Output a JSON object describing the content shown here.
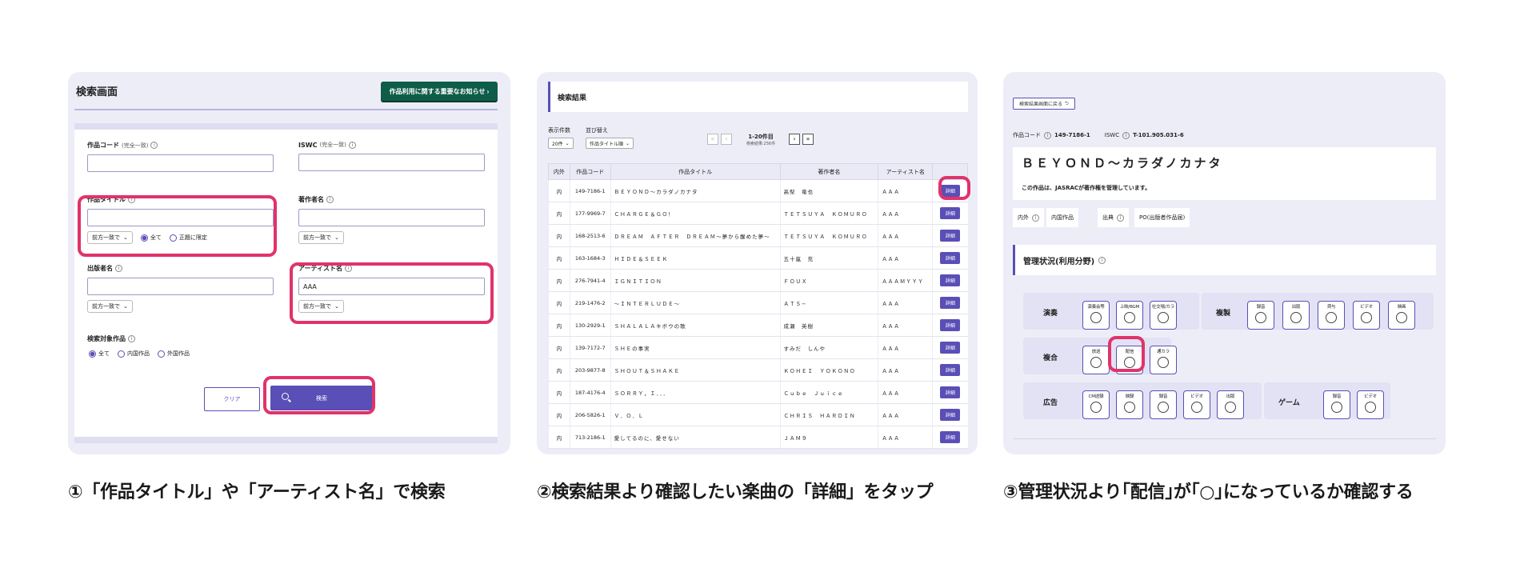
{
  "panel1": {
    "title": "検索画面",
    "notice_button": "作品利用に関する重要なお知らせ ›",
    "fields": {
      "work_code": {
        "label": "作品コード",
        "sub": "(完全一致)",
        "value": ""
      },
      "iswc": {
        "label": "ISWC",
        "sub": "(完全一致)",
        "value": ""
      },
      "title": {
        "label": "作品タイトル",
        "value": "",
        "match": "前方一致で",
        "radios": [
          "全て",
          "正題に限定"
        ],
        "selected": "全て"
      },
      "author": {
        "label": "著作者名",
        "value": "",
        "match": "前方一致で"
      },
      "publisher": {
        "label": "出版者名",
        "value": "",
        "match": "前方一致で"
      },
      "artist": {
        "label": "アーティスト名",
        "value": "AAA",
        "match": "前方一致で"
      },
      "target": {
        "label": "検索対象作品",
        "radios": [
          "全て",
          "内国作品",
          "外国作品"
        ],
        "selected": "全て"
      }
    },
    "clear_button": "クリア",
    "search_button": "検索",
    "caption": "①「作品タイトル」や「アーティスト名」で検索"
  },
  "panel2": {
    "header": "検索結果",
    "display_count": {
      "label": "表示件数",
      "value": "20件"
    },
    "sort": {
      "label": "並び替え",
      "value": "作品タイトル順"
    },
    "page_range": "1-20件目",
    "total": "検索結果:256件",
    "columns": [
      "内外",
      "作品コード",
      "作品タイトル",
      "著作者名",
      "アーティスト名",
      ""
    ],
    "detail_label": "詳細",
    "rows": [
      {
        "io": "内",
        "code": "149-7186-1",
        "title": "ＢＥＹＯＮＤ〜カラダノカナタ",
        "author": "高梨　竜也",
        "artist": "ＡＡＡ"
      },
      {
        "io": "内",
        "code": "177-9969-7",
        "title": "ＣＨＡＲＧＥ＆ＧＯ！",
        "author": "ＴＥＴＳＵＹＡ　ＫＯＭＵＲＯ",
        "artist": "ＡＡＡ"
      },
      {
        "io": "内",
        "code": "168-2513-6",
        "title": "ＤＲＥＡＭ　ＡＦＴＥＲ　ＤＲＥＡＭ〜夢から醒めた夢〜",
        "author": "ＴＥＴＳＵＹＡ　ＫＯＭＵＲＯ",
        "artist": "ＡＡＡ"
      },
      {
        "io": "内",
        "code": "163-1684-3",
        "title": "ＨＩＤＥ＆ＳＥＥＫ",
        "author": "五十嵐　充",
        "artist": "ＡＡＡ"
      },
      {
        "io": "内",
        "code": "276-7941-4",
        "title": "ＩＧＮＩＴＩＯＮ",
        "author": "ＦＯＵＸ",
        "artist": "ＡＡＡＭＹＹＹ"
      },
      {
        "io": "内",
        "code": "219-1476-2",
        "title": "〜ＩＮＴＥＲＬＵＤＥ〜",
        "author": "ＡＴＳ−",
        "artist": "ＡＡＡ"
      },
      {
        "io": "内",
        "code": "130-2929-1",
        "title": "ＳＨＡＬＡＬＡキボウの歌",
        "author": "成瀬　英樹",
        "artist": "ＡＡＡ"
      },
      {
        "io": "内",
        "code": "139-7172-7",
        "title": "ＳＨＥの事実",
        "author": "すみだ　しんや",
        "artist": "ＡＡＡ"
      },
      {
        "io": "内",
        "code": "203-9877-8",
        "title": "ＳＨＯＵＴ＆ＳＨＡＫＥ",
        "author": "ＫＯＨＥＩ　ＹＯＫＯＮＯ",
        "artist": "ＡＡＡ"
      },
      {
        "io": "内",
        "code": "187-4176-4",
        "title": "ＳＯＲＲＹ，Ｉ．．．",
        "author": "Ｃｕｂｅ　Ｊｕｉｃｅ",
        "artist": "ＡＡＡ"
      },
      {
        "io": "内",
        "code": "206-5826-1",
        "title": "Ｖ．Ｏ．Ｌ",
        "author": "ＣＨＲＩＳ　ＨＡＲＤＩＮ",
        "artist": "ＡＡＡ"
      },
      {
        "io": "内",
        "code": "713-2186-1",
        "title": "愛してるのに、愛せない",
        "author": "ＪＡＭ９",
        "artist": "ＡＡＡ"
      }
    ],
    "caption": "②検索結果より確認したい楽曲の「詳細」をタップ"
  },
  "panel3": {
    "back_button": "検索結果画面に戻る",
    "work_code_label": "作品コード",
    "work_code": "149-7186-1",
    "iswc_label": "ISWC",
    "iswc": "T-101.905.031-6",
    "work_title": "ＢＥＹＯＮＤ〜カラダノカナタ",
    "managed_note": "この作品は、JASRACが著作権を管理しています。",
    "io_label": "内外",
    "io_value": "内国作品",
    "pub_label": "出典",
    "pub_value": "PO(出版者作品届)",
    "status_header": "管理状況(利用分野)",
    "groups": {
      "perform": {
        "label": "演奏",
        "items": [
          "演奏会等",
          "上映/BGM",
          "社交場/カラ"
        ]
      },
      "copy": {
        "label": "複製",
        "items": [
          "録音",
          "出版",
          "貸与",
          "ビデオ",
          "映画"
        ]
      },
      "complex": {
        "label": "複合",
        "items": [
          "放送",
          "配信",
          "通カラ"
        ]
      },
      "ad": {
        "label": "広告",
        "items": [
          "CM送録",
          "映録",
          "録音",
          "ビデオ",
          "出版"
        ]
      },
      "game": {
        "label": "ゲーム",
        "items": [
          "録音",
          "ビデオ"
        ]
      }
    },
    "caption": "③管理状況より｢配信｣が｢○｣になっているか確認する"
  },
  "colors": {
    "accent": "#5a4fb6",
    "highlight": "#e0336a",
    "notice": "#0e5d49",
    "panel_bg": "#ededf8"
  }
}
